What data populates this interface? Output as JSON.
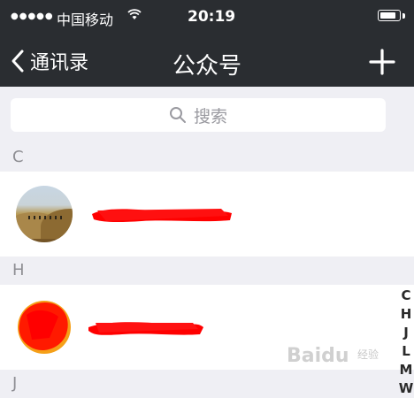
{
  "status_bar": {
    "signal": "●●●●●",
    "carrier": "中国移动",
    "wifi_icon": "wifi-icon",
    "time": "20:19",
    "battery_icon": "battery-icon",
    "battery_level": 0.85
  },
  "nav": {
    "back_label": "通讯录",
    "back_icon": "chevron-left-icon",
    "title": "公众号",
    "add_icon": "plus-icon"
  },
  "search": {
    "icon": "search-icon",
    "placeholder": "搜索"
  },
  "sections": [
    {
      "letter": "C"
    },
    {
      "letter": "H"
    },
    {
      "letter": "J"
    }
  ],
  "index_bar": {
    "letters": [
      "C",
      "H",
      "J",
      "L",
      "M",
      "W"
    ]
  },
  "watermark": {
    "text": "Baidu",
    "sub": "经验"
  },
  "colors": {
    "bar": "#2a2d31",
    "background": "#efeff4",
    "redaction": "#ff0000"
  }
}
